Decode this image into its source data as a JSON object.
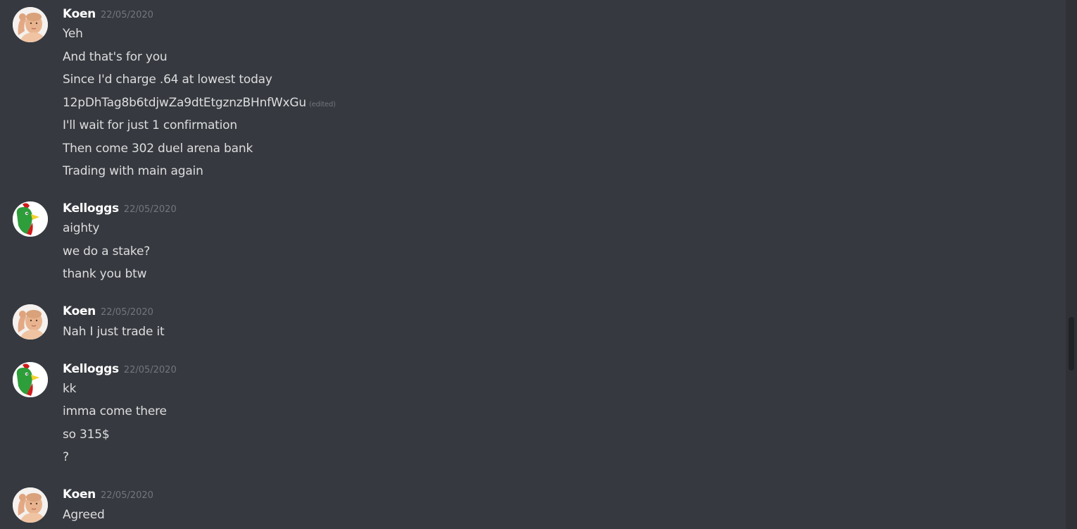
{
  "messages": [
    {
      "author": "Koen",
      "avatar": "baby-flexing-avatar",
      "timestamp": "22/05/2020",
      "lines": [
        {
          "text": "Yeh"
        },
        {
          "text": "And that's for you"
        },
        {
          "text": "Since I'd charge .64 at lowest today"
        },
        {
          "text": "12pDhTag8b6tdjwZa9dtEtgznzBHnfWxGu",
          "edited": "(edited)"
        },
        {
          "text": "I'll wait for just 1 confirmation"
        },
        {
          "text": "Then come 302 duel arena bank"
        },
        {
          "text": "Trading with main again"
        }
      ]
    },
    {
      "author": "Kelloggs",
      "avatar": "green-rooster-avatar",
      "timestamp": "22/05/2020",
      "lines": [
        {
          "text": "aighty"
        },
        {
          "text": "we do a stake?"
        },
        {
          "text": "thank you btw"
        }
      ]
    },
    {
      "author": "Koen",
      "avatar": "baby-flexing-avatar",
      "timestamp": "22/05/2020",
      "lines": [
        {
          "text": "Nah I just trade it"
        }
      ]
    },
    {
      "author": "Kelloggs",
      "avatar": "green-rooster-avatar",
      "timestamp": "22/05/2020",
      "lines": [
        {
          "text": "kk"
        },
        {
          "text": "imma come there"
        },
        {
          "text": "so 315$"
        },
        {
          "text": "?"
        }
      ]
    },
    {
      "author": "Koen",
      "avatar": "baby-flexing-avatar",
      "timestamp": "22/05/2020",
      "lines": [
        {
          "text": "Agreed"
        }
      ]
    }
  ],
  "colors": {
    "background": "#36393f",
    "username": "#ffffff",
    "message_text": "#dcddde",
    "timestamp": "#72767d"
  }
}
